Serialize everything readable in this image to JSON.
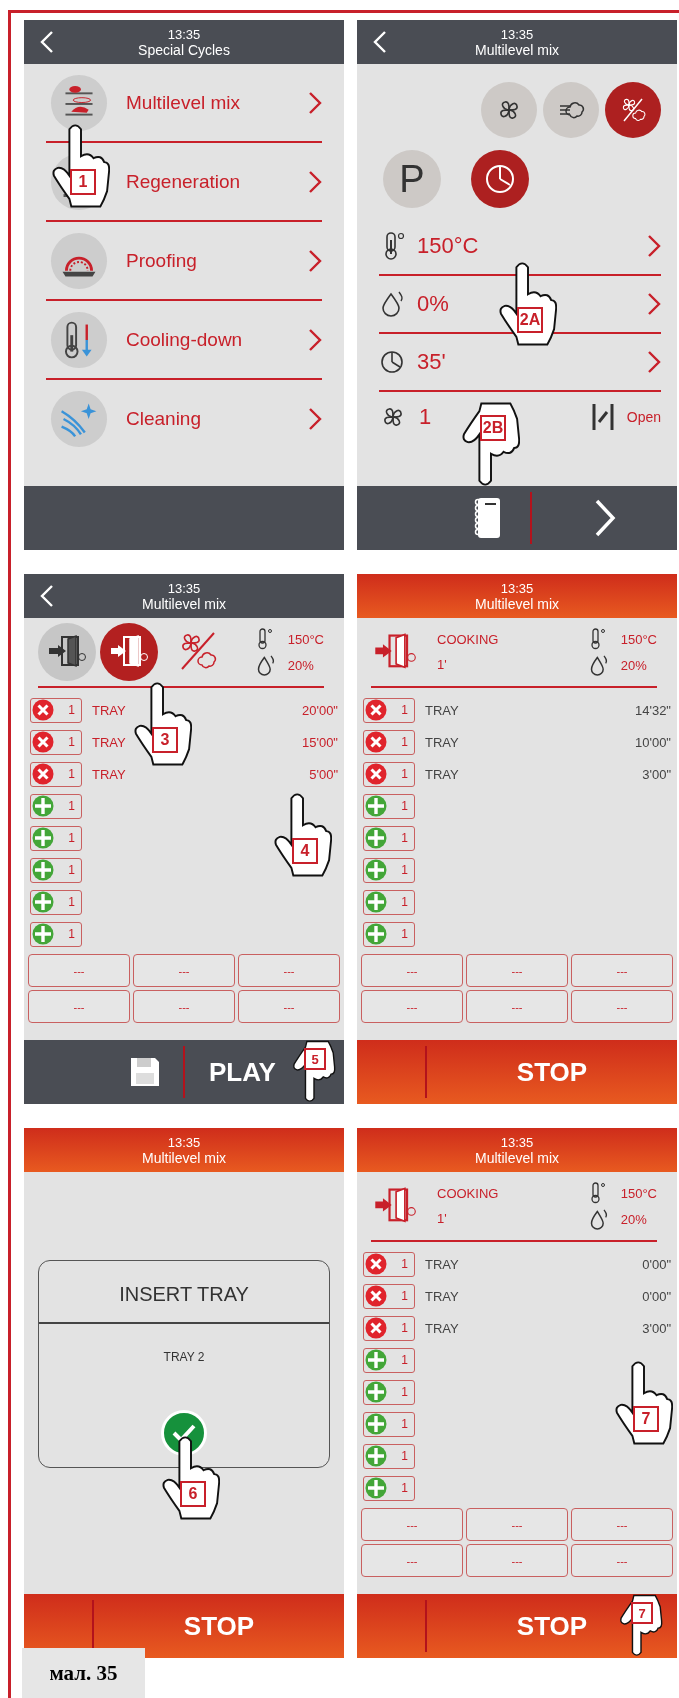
{
  "screens": [
    {
      "kind": "menu",
      "running": false,
      "back_button": true,
      "time": "13:35",
      "title": "Special Cycles",
      "items": [
        {
          "label": "Multilevel mix"
        },
        {
          "label": "Regeneration"
        },
        {
          "label": "Proofing"
        },
        {
          "label": "Cooling-down"
        },
        {
          "label": "Cleaning"
        }
      ],
      "footer": {
        "kind": "empty"
      },
      "callouts": [
        {
          "label": "1",
          "points_down": false
        }
      ]
    },
    {
      "kind": "settings",
      "running": false,
      "back_button": true,
      "time": "13:35",
      "title": "Multilevel mix",
      "modes": [
        {
          "selected": false
        },
        {
          "selected": false
        },
        {
          "selected": true
        }
      ],
      "programs": [
        {
          "label": "P",
          "selected": false
        },
        {
          "selected": true
        }
      ],
      "params": [
        {
          "value": "150°C"
        },
        {
          "value": "0%"
        },
        {
          "value": "35'"
        }
      ],
      "fan_speed": "1",
      "damper": "Open",
      "footer": {
        "kind": "recipes_next"
      },
      "callouts": [
        {
          "label": "2A",
          "points_down": false
        },
        {
          "label": "2B",
          "points_down": true
        }
      ]
    },
    {
      "kind": "trays",
      "running": false,
      "back_button": true,
      "time": "13:35",
      "title": "Multilevel mix",
      "doors": [
        {
          "selected": false
        },
        {
          "selected": true
        }
      ],
      "temperature": "150°C",
      "humidity": "20%",
      "trays": [
        {
          "kind": "active",
          "number": "1",
          "label": "TRAY",
          "time": "20'00\""
        },
        {
          "kind": "active",
          "number": "1",
          "label": "TRAY",
          "time": "15'00\""
        },
        {
          "kind": "active",
          "number": "1",
          "label": "TRAY",
          "time": "5'00\""
        },
        {
          "kind": "empty",
          "number": "1"
        },
        {
          "kind": "empty",
          "number": "1"
        },
        {
          "kind": "empty",
          "number": "1"
        },
        {
          "kind": "empty",
          "number": "1"
        },
        {
          "kind": "empty",
          "number": "1"
        }
      ],
      "slots": [
        "---",
        "---",
        "---",
        "---",
        "---",
        "---"
      ],
      "footer": {
        "kind": "save_play",
        "button": "PLAY"
      },
      "callouts": [
        {
          "label": "3",
          "points_down": false
        },
        {
          "label": "4",
          "points_down": false
        },
        {
          "label": "5",
          "points_down": true
        }
      ]
    },
    {
      "kind": "trays",
      "running": true,
      "back_button": false,
      "time": "13:35",
      "title": "Multilevel mix",
      "status": {
        "label": "COOKING",
        "time": "1'"
      },
      "temperature": "150°C",
      "humidity": "20%",
      "trays": [
        {
          "kind": "active",
          "number": "1",
          "label": "TRAY",
          "time": "14'32\""
        },
        {
          "kind": "active",
          "number": "1",
          "label": "TRAY",
          "time": "10'00\""
        },
        {
          "kind": "active",
          "number": "1",
          "label": "TRAY",
          "time": "3'00\""
        },
        {
          "kind": "empty",
          "number": "1"
        },
        {
          "kind": "empty",
          "number": "1"
        },
        {
          "kind": "empty",
          "number": "1"
        },
        {
          "kind": "empty",
          "number": "1"
        },
        {
          "kind": "empty",
          "number": "1"
        }
      ],
      "slots": [
        "---",
        "---",
        "---",
        "---",
        "---",
        "---"
      ],
      "footer": {
        "kind": "stop",
        "button": "STOP"
      }
    },
    {
      "kind": "dialog",
      "running": true,
      "back_button": false,
      "time": "13:35",
      "title": "Multilevel mix",
      "dialog": {
        "title": "INSERT TRAY",
        "message": "TRAY 2"
      },
      "footer": {
        "kind": "stop",
        "button": "STOP"
      },
      "callouts": [
        {
          "label": "6",
          "points_down": false
        }
      ]
    },
    {
      "kind": "trays",
      "running": true,
      "back_button": false,
      "time": "13:35",
      "title": "Multilevel mix",
      "status": {
        "label": "COOKING",
        "time": "1'"
      },
      "temperature": "150°C",
      "humidity": "20%",
      "trays": [
        {
          "kind": "active",
          "number": "1",
          "label": "TRAY",
          "time": "0'00\""
        },
        {
          "kind": "active",
          "number": "1",
          "label": "TRAY",
          "time": "0'00\""
        },
        {
          "kind": "active",
          "number": "1",
          "label": "TRAY",
          "time": "3'00\""
        },
        {
          "kind": "empty",
          "number": "1"
        },
        {
          "kind": "empty",
          "number": "1"
        },
        {
          "kind": "empty",
          "number": "1"
        },
        {
          "kind": "empty",
          "number": "1"
        },
        {
          "kind": "empty",
          "number": "1"
        }
      ],
      "slots": [
        "---",
        "---",
        "---",
        "---",
        "---",
        "---"
      ],
      "footer": {
        "kind": "stop",
        "button": "STOP"
      },
      "callouts": [
        {
          "label": "7",
          "points_down": false
        },
        {
          "label": "7",
          "points_down": true
        }
      ]
    }
  ],
  "caption": "мал. 35"
}
